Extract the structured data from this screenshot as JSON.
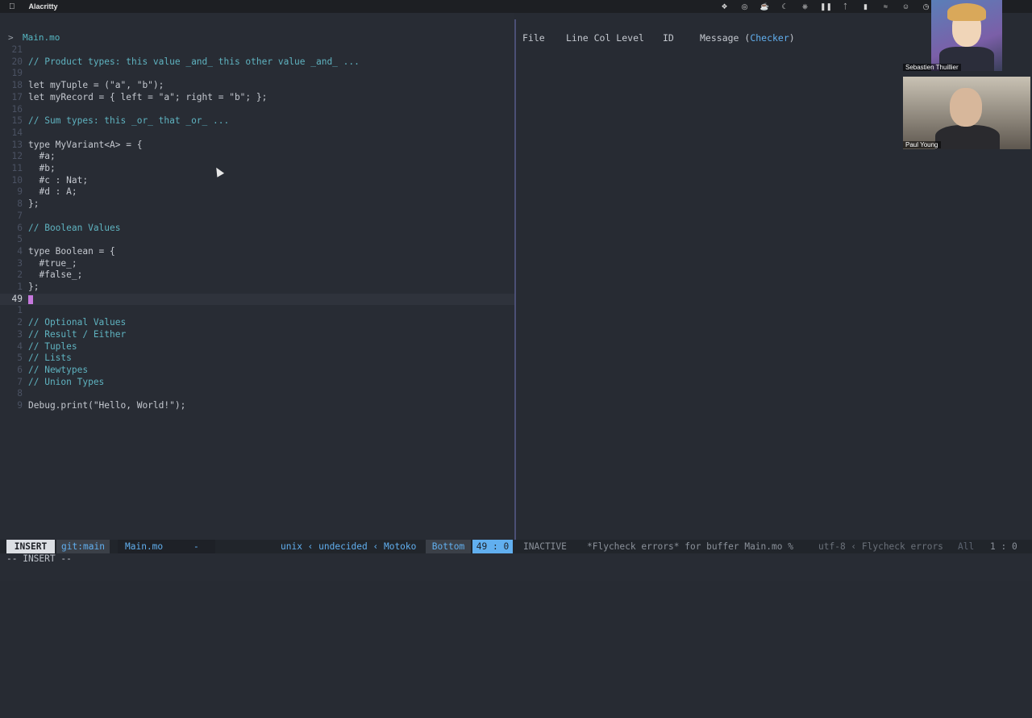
{
  "menubar": {
    "apple_icon": "apple-icon",
    "app_name": "Alacritty",
    "tray_icons": [
      "dropbox-icon",
      "circle-icon",
      "coffee-icon",
      "moon-icon",
      "fork-icon",
      "pause-icon",
      "bluetooth-icon",
      "battery-icon",
      "wifi-icon",
      "user-icon",
      "clock-icon"
    ]
  },
  "editor": {
    "prompt": ">",
    "file_name": "Main.mo",
    "cursor_color": "#c678dd",
    "lines": [
      {
        "num": "21",
        "text": "",
        "kind": "plain"
      },
      {
        "num": "20",
        "text": "// Product types: this value _and_ this other value _and_ ...",
        "kind": "comment"
      },
      {
        "num": "19",
        "text": "",
        "kind": "plain"
      },
      {
        "num": "18",
        "text": "let myTuple = (\"a\", \"b\");",
        "kind": "plain"
      },
      {
        "num": "17",
        "text": "let myRecord = { left = \"a\"; right = \"b\"; };",
        "kind": "plain"
      },
      {
        "num": "16",
        "text": "",
        "kind": "plain"
      },
      {
        "num": "15",
        "text": "// Sum types: this _or_ that _or_ ...",
        "kind": "comment"
      },
      {
        "num": "14",
        "text": "",
        "kind": "plain"
      },
      {
        "num": "13",
        "text": "type MyVariant<A> = {",
        "kind": "plain"
      },
      {
        "num": "12",
        "text": "  #a;",
        "kind": "plain"
      },
      {
        "num": "11",
        "text": "  #b;",
        "kind": "plain"
      },
      {
        "num": "10",
        "text": "  #c : Nat;",
        "kind": "plain"
      },
      {
        "num": "9",
        "text": "  #d : A;",
        "kind": "plain"
      },
      {
        "num": "8",
        "text": "};",
        "kind": "plain"
      },
      {
        "num": "7",
        "text": "",
        "kind": "plain"
      },
      {
        "num": "6",
        "text": "// Boolean Values",
        "kind": "comment"
      },
      {
        "num": "5",
        "text": "",
        "kind": "plain"
      },
      {
        "num": "4",
        "text": "type Boolean = {",
        "kind": "plain"
      },
      {
        "num": "3",
        "text": "  #true_;",
        "kind": "plain"
      },
      {
        "num": "2",
        "text": "  #false_;",
        "kind": "plain"
      },
      {
        "num": "1",
        "text": "};",
        "kind": "plain"
      },
      {
        "num": "49",
        "text": "",
        "kind": "current"
      },
      {
        "num": "1",
        "text": "",
        "kind": "plain"
      },
      {
        "num": "2",
        "text": "// Optional Values",
        "kind": "comment"
      },
      {
        "num": "3",
        "text": "// Result / Either",
        "kind": "comment"
      },
      {
        "num": "4",
        "text": "// Tuples",
        "kind": "comment"
      },
      {
        "num": "5",
        "text": "// Lists",
        "kind": "comment"
      },
      {
        "num": "6",
        "text": "// Newtypes",
        "kind": "comment"
      },
      {
        "num": "7",
        "text": "// Union Types",
        "kind": "comment"
      },
      {
        "num": "8",
        "text": "",
        "kind": "plain"
      },
      {
        "num": "9",
        "text": "Debug.print(\"Hello, World!\");",
        "kind": "plain"
      }
    ]
  },
  "errors_panel": {
    "col_file": "File",
    "col_line_col_level": "Line Col Level",
    "col_id": "ID",
    "col_message": "Message (",
    "checker": "Checker",
    "close_paren": ")"
  },
  "video": {
    "person1": "Sebastien Thuillier",
    "person2": "Paul Young"
  },
  "statusbar": {
    "mode": "INSERT",
    "git": "git:main",
    "file": "Main.mo",
    "modified": "-",
    "encoding_info": "unix ‹ undecided ‹ Motoko",
    "scroll": "Bottom",
    "position": "49 : 0",
    "right_state": "INACTIVE",
    "right_buffer": "*Flycheck errors* for buffer Main.mo %",
    "right_encoding": "utf-8 ‹ Flycheck errors",
    "right_scroll": "All",
    "right_position": "1 : 0"
  },
  "minibuffer": "-- INSERT --"
}
